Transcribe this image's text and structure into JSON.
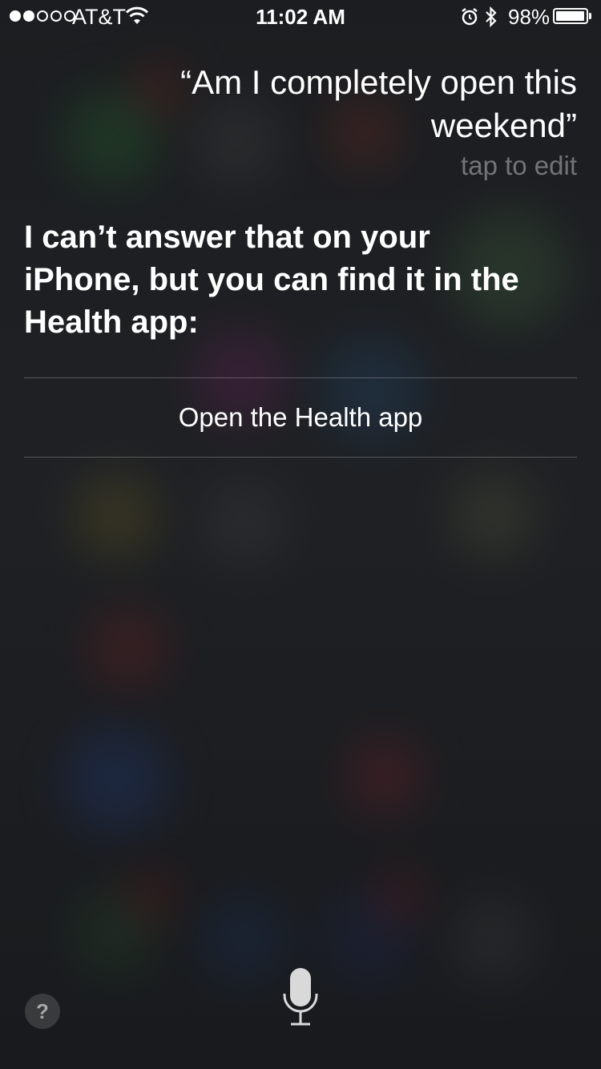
{
  "status_bar": {
    "carrier": "AT&T",
    "signal_bars_filled": 2,
    "signal_bars_total": 5,
    "time": "11:02 AM",
    "battery_percent_label": "98%",
    "battery_level": 0.98,
    "icons": [
      "wifi-icon",
      "alarm-icon",
      "bluetooth-icon",
      "battery-icon"
    ]
  },
  "siri": {
    "query_text": "“Am I completely open this weekend”",
    "tap_to_edit": "tap to edit",
    "response_text": "I can’t answer that on your iPhone, but you can find it in the Health app:",
    "action_label": "Open the Health app"
  },
  "controls": {
    "help_label": "?",
    "help_icon": "question-icon",
    "mic_icon": "microphone-icon"
  },
  "colors": {
    "text": "#ffffff",
    "secondary_text": "rgba(255,255,255,0.38)",
    "divider": "rgba(255,255,255,0.25)"
  }
}
